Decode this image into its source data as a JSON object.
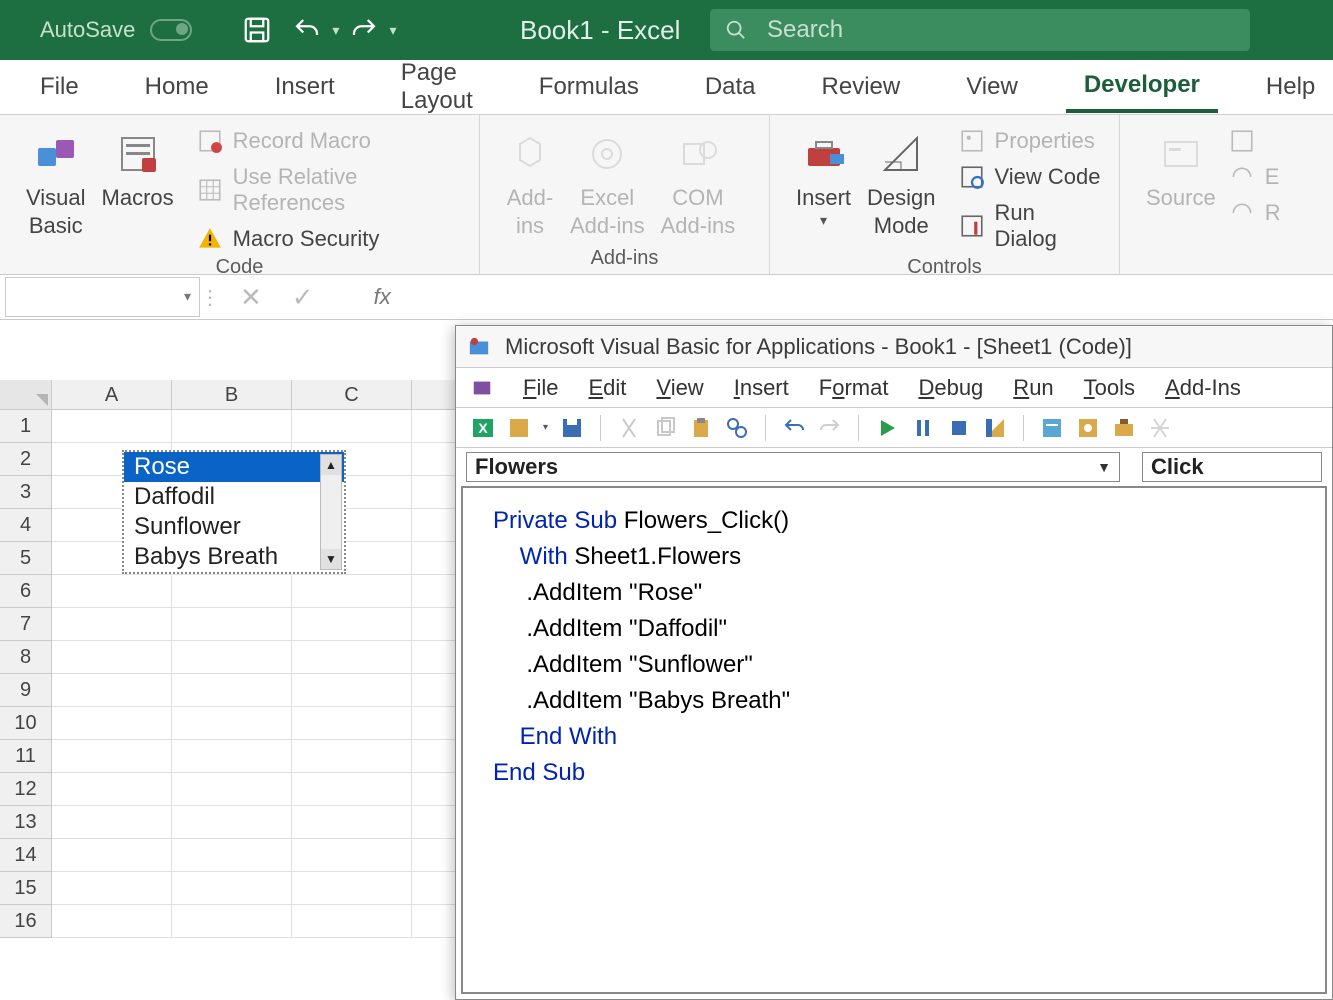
{
  "titlebar": {
    "autosave": "AutoSave",
    "autosave_state": "Off",
    "app_title": "Book1 - Excel",
    "search_placeholder": "Search"
  },
  "tabs": [
    "File",
    "Home",
    "Insert",
    "Page Layout",
    "Formulas",
    "Data",
    "Review",
    "View",
    "Developer",
    "Help"
  ],
  "active_tab": "Developer",
  "ribbon": {
    "code": {
      "label": "Code",
      "visual_basic": "Visual",
      "visual_basic_line2": "Basic",
      "macros": "Macros",
      "record_macro": "Record Macro",
      "use_relative": "Use Relative References",
      "macro_security": "Macro Security"
    },
    "addins": {
      "label": "Add-ins",
      "addins1": "Add-",
      "addins1b": "ins",
      "excel_addins1": "Excel",
      "excel_addins2": "Add-ins",
      "com1": "COM",
      "com2": "Add-ins"
    },
    "controls": {
      "label": "Controls",
      "insert": "Insert",
      "design1": "Design",
      "design2": "Mode",
      "properties": "Properties",
      "view_code": "View Code",
      "run_dialog": "Run Dialog"
    },
    "xml": {
      "source": "Source",
      "e": "E",
      "r": "R"
    }
  },
  "formula_bar": {
    "fx": "fx"
  },
  "grid": {
    "cols": [
      "A",
      "B",
      "C"
    ],
    "rows": [
      "1",
      "2",
      "3",
      "4",
      "5",
      "6",
      "7",
      "8",
      "9",
      "10",
      "11",
      "12",
      "13",
      "14",
      "15",
      "16"
    ]
  },
  "listbox": {
    "items": [
      "Rose",
      "Daffodil",
      "Sunflower",
      "Babys Breath"
    ],
    "selected": 0
  },
  "vbe": {
    "title": "Microsoft Visual Basic for Applications - Book1 - [Sheet1 (Code)]",
    "menu": [
      "File",
      "Edit",
      "View",
      "Insert",
      "Format",
      "Debug",
      "Run",
      "Tools",
      "Add-Ins"
    ],
    "object_drop": "Flowers",
    "proc_drop": "Click",
    "code_lines": [
      {
        "t": "Private Sub ",
        "k": true,
        "rest": "Flowers_Click()"
      },
      {
        "t": "",
        "k": false,
        "rest": ""
      },
      {
        "t": "    With ",
        "k": true,
        "rest": "Sheet1.Flowers"
      },
      {
        "t": "",
        "k": false,
        "rest": ""
      },
      {
        "t": "     .AddItem ",
        "k": false,
        "rest": "\"Rose\""
      },
      {
        "t": "     .AddItem ",
        "k": false,
        "rest": "\"Daffodil\""
      },
      {
        "t": "     .AddItem ",
        "k": false,
        "rest": "\"Sunflower\""
      },
      {
        "t": "     .AddItem ",
        "k": false,
        "rest": "\"Babys Breath\""
      },
      {
        "t": "",
        "k": false,
        "rest": ""
      },
      {
        "t": "    End With",
        "k": true,
        "rest": ""
      },
      {
        "t": "",
        "k": false,
        "rest": ""
      },
      {
        "t": "End Sub",
        "k": true,
        "rest": ""
      }
    ]
  }
}
